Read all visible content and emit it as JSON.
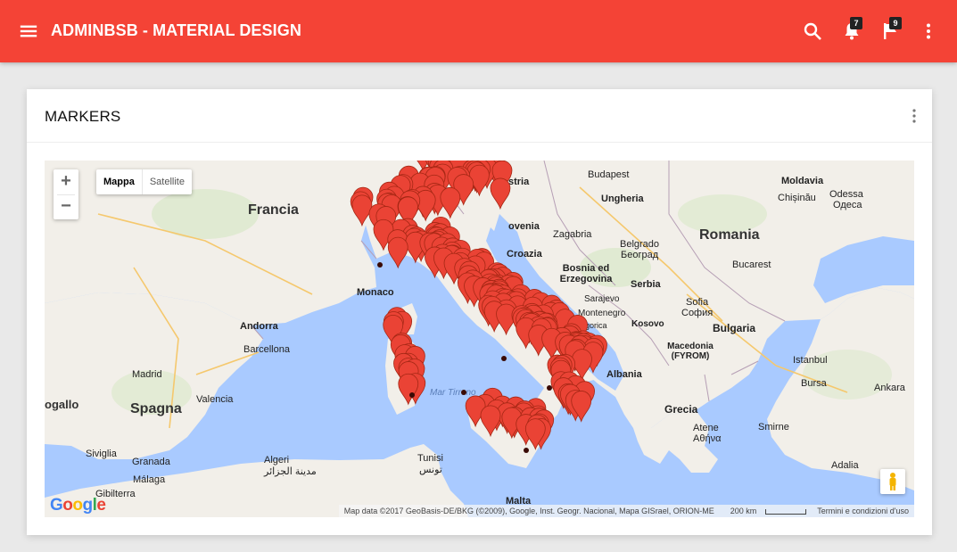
{
  "navbar": {
    "title": "ADMINBSB - MATERIAL DESIGN",
    "notifications_count": "7",
    "tasks_count": "9",
    "color": "#f44336"
  },
  "card": {
    "title": "MARKERS"
  },
  "map": {
    "zoom_in": "+",
    "zoom_out": "−",
    "maptype_map": "Mappa",
    "maptype_satellite": "Satellite",
    "logo": "Google",
    "attribution": "Map data ©2017 GeoBasis-DE/BKG (©2009), Google, Inst. Geogr. Nacional, Mapa GISrael, ORION-ME",
    "scale": "200 km",
    "terms": "Termini e condizioni d'uso",
    "labels": {
      "francia": "Francia",
      "spagna": "Spagna",
      "romania": "Romania",
      "ungheria": "Ungheria",
      "bulgaria": "Bulgaria",
      "grecia": "Grecia",
      "serbia": "Serbia",
      "albania": "Albania",
      "austria": "stria",
      "slovenia": "ovenia",
      "croazia": "Croazia",
      "bosnia": "Bosnia ed Erzegovina",
      "montenegro": "Montenegro",
      "kosovo": "Kosovo",
      "macedonia": "Macedonia (FYROM)",
      "moldavia": "Moldavia",
      "budapest": "Budapest",
      "zagabria": "Zagabria",
      "belgrado": "Belgrado",
      "belgrado_cyr": "Београд",
      "sarajevo": "Sarajevo",
      "podgorica": "Podgorica",
      "bucarest": "Bucarest",
      "sofia": "Sofia",
      "sofia_cyr": "София",
      "istanbul": "Istanbul",
      "bursa": "Bursa",
      "ankara": "Ankara",
      "izmir": "Smirne",
      "atene": "Atene",
      "atene_gr": "Αθήνα",
      "antalya": "Adalia",
      "odessa": "Odessa",
      "odessa_cyr": "Одеса",
      "chisinau": "Chișinău",
      "monaco": "Monaco",
      "andorra": "Andorra",
      "barcellona": "Barcellona",
      "madrid": "Madrid",
      "valencia": "Valencia",
      "siviglia": "Siviglia",
      "granada": "Granada",
      "malaga": "Málaga",
      "gibilterra": "Gibilterra",
      "algeri": "Algeri",
      "algeri_ar": "مدينة الجزائر",
      "tunisi": "Tunisi",
      "tunisi_ar": "تونس",
      "malta": "Malta",
      "mar_tirreno": "Mar Tirreno",
      "ogallo": "ogallo"
    }
  },
  "colors": {
    "marker": "#ea4335",
    "marker_dark": "#a52714",
    "water": "#a9caff",
    "land": "#f2efe9"
  }
}
